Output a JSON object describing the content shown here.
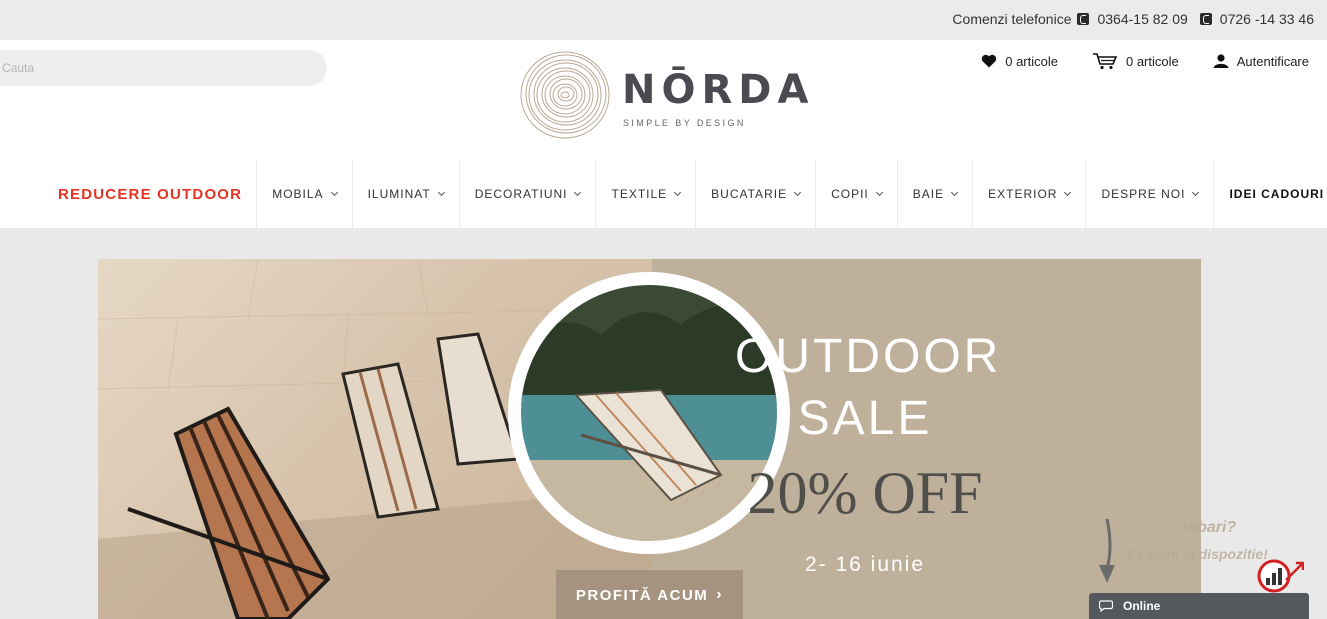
{
  "topbar": {
    "label": "Comenzi telefonice",
    "phone1": "0364-15 82 09",
    "phone2": "0726 -14 33 46"
  },
  "search": {
    "placeholder": "Cauta"
  },
  "logo": {
    "name": "NŌRDA",
    "tagline": "SIMPLE BY DESIGN"
  },
  "actions": {
    "wishlist": "0 articole",
    "cart": "0 articole",
    "login": "Autentificare"
  },
  "nav": {
    "items": [
      "REDUCERE OUTDOOR",
      "MOBILA",
      "ILUMINAT",
      "DECORATIUNI",
      "TEXTILE",
      "BUCATARIE",
      "COPII",
      "BAIE",
      "EXTERIOR",
      "DESPRE NOI",
      "IDEI CADOURI"
    ]
  },
  "banner": {
    "line1": "OUTDOOR",
    "line2": "SALE",
    "discount": "20% OFF",
    "dates": "2- 16 iunie",
    "cta": "PROFITĂ ACUM"
  },
  "chat": {
    "question": "rebari?",
    "subtitle": "Va stam la dispozitie!",
    "status": "Online"
  },
  "colors": {
    "accent_red": "#e53222",
    "banner_beige": "#bfb09b",
    "cta_brown": "#a5937f",
    "chat_bar": "#55595e"
  }
}
